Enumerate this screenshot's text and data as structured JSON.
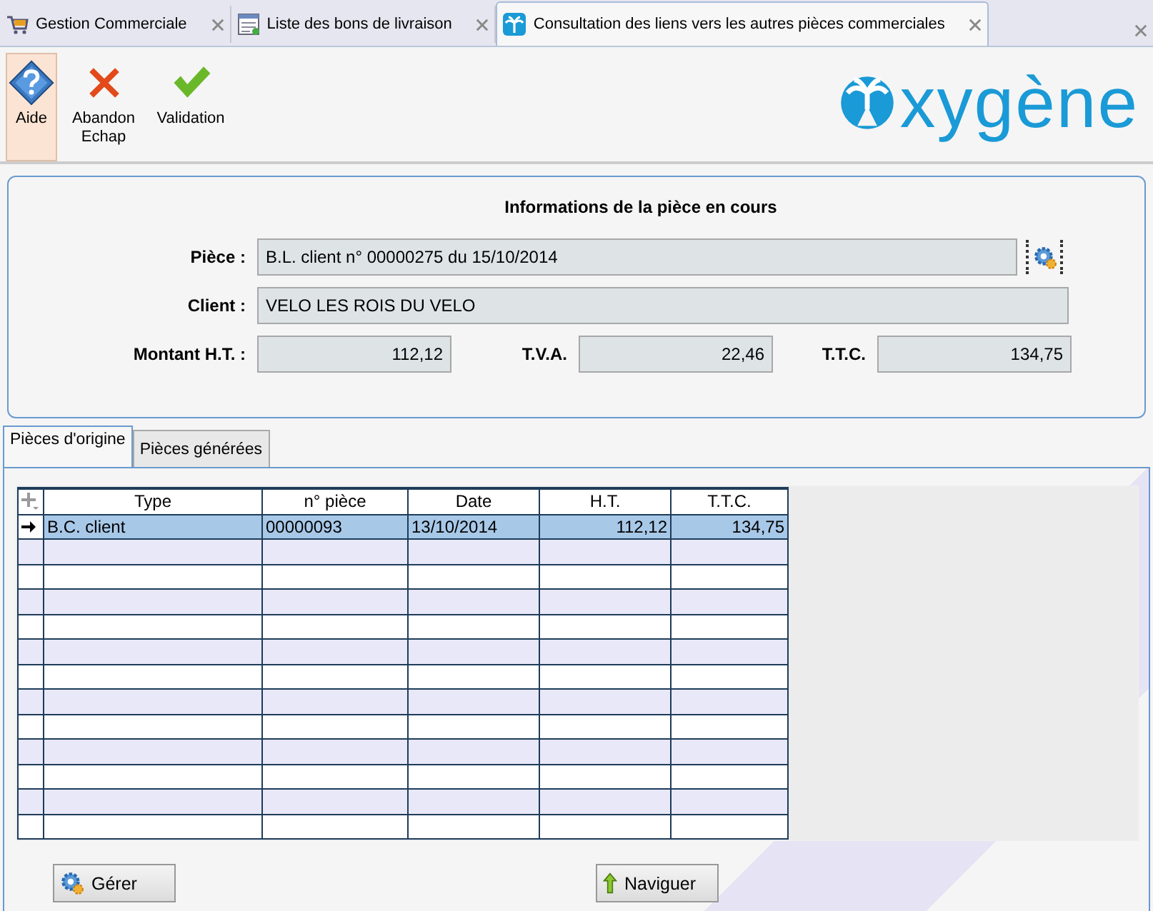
{
  "tabs": [
    {
      "label": "Gestion Commerciale",
      "kind": "cart",
      "selected": false
    },
    {
      "label": "Liste des bons de livraison",
      "kind": "list",
      "selected": false
    },
    {
      "label": "Consultation des liens vers les autres pièces commerciales",
      "kind": "palm",
      "selected": true
    }
  ],
  "toolbar": [
    {
      "label": "Aide",
      "kind": "help",
      "selected": true
    },
    {
      "label": "Abandon\nEchap",
      "kind": "cancel",
      "selected": false
    },
    {
      "label": "Validation",
      "kind": "ok",
      "selected": false
    }
  ],
  "logo": "xygène",
  "info": {
    "title": "Informations de la pièce en cours",
    "piece_label": "Pièce :",
    "piece": "B.L. client n° 00000275 du 15/10/2014",
    "client_label": "Client :",
    "client": "VELO LES ROIS DU VELO",
    "amounts": [
      {
        "label": "Montant H.T. :",
        "value": "112,12"
      },
      {
        "label": "T.V.A.",
        "value": "22,46"
      },
      {
        "label": "T.T.C.",
        "value": "134,75"
      }
    ]
  },
  "subtabs": [
    {
      "label": "Pièces d'origine",
      "selected": true
    },
    {
      "label": "Pièces générées",
      "selected": false
    }
  ],
  "table": {
    "columns": [
      "Type",
      "n° pièce",
      "Date",
      "H.T.",
      "T.T.C."
    ],
    "rows": [
      {
        "cells": [
          "B.C. client",
          "00000093",
          "13/10/2014",
          "112,12",
          "134,75"
        ],
        "selected": true
      }
    ]
  },
  "buttons": [
    {
      "label": "Gérer",
      "kind": "manage"
    },
    {
      "label": "Naviguer",
      "kind": "navigate"
    }
  ]
}
